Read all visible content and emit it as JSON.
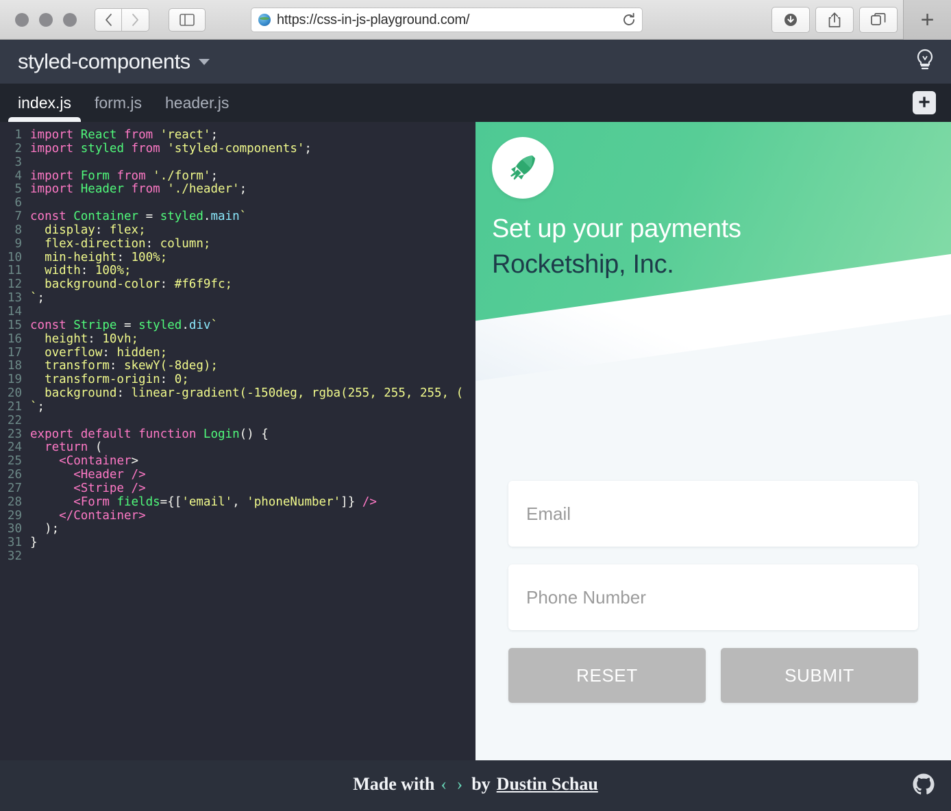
{
  "browser": {
    "url": "https://css-in-js-playground.com/",
    "back_label": "‹",
    "forward_label": "›",
    "new_tab_label": "+",
    "icons": {
      "sidebar": "sidebar-icon",
      "reload": "reload-icon",
      "downloads": "downloads-icon",
      "share": "share-icon",
      "tabs": "tab-overview-icon",
      "globe": "globe-icon"
    }
  },
  "app_header": {
    "project_name": "styled-components",
    "dropdown_icon": "chevron-down-icon",
    "theme_toggle_icon": "lightbulb-icon"
  },
  "tabbar": {
    "tabs": [
      {
        "label": "index.js",
        "active": true
      },
      {
        "label": "form.js",
        "active": false
      },
      {
        "label": "header.js",
        "active": false
      }
    ],
    "add_file_label": "+"
  },
  "editor": {
    "language": "jsx",
    "total_lines": 32,
    "lines": [
      {
        "n": 1,
        "text": "import React from 'react';"
      },
      {
        "n": 2,
        "text": "import styled from 'styled-components';"
      },
      {
        "n": 3,
        "text": ""
      },
      {
        "n": 4,
        "text": "import Form from './form';"
      },
      {
        "n": 5,
        "text": "import Header from './header';"
      },
      {
        "n": 6,
        "text": ""
      },
      {
        "n": 7,
        "text": "const Container = styled.main`"
      },
      {
        "n": 8,
        "text": "  display: flex;"
      },
      {
        "n": 9,
        "text": "  flex-direction: column;"
      },
      {
        "n": 10,
        "text": "  min-height: 100%;"
      },
      {
        "n": 11,
        "text": "  width: 100%;"
      },
      {
        "n": 12,
        "text": "  background-color: #f6f9fc;"
      },
      {
        "n": 13,
        "text": "`;"
      },
      {
        "n": 14,
        "text": ""
      },
      {
        "n": 15,
        "text": "const Stripe = styled.div`"
      },
      {
        "n": 16,
        "text": "  height: 10vh;"
      },
      {
        "n": 17,
        "text": "  overflow: hidden;"
      },
      {
        "n": 18,
        "text": "  transform: skewY(-8deg);"
      },
      {
        "n": 19,
        "text": "  transform-origin: 0;"
      },
      {
        "n": 20,
        "text": "  background: linear-gradient(-150deg, rgba(255, 255, 255, ("
      },
      {
        "n": 21,
        "text": "`;"
      },
      {
        "n": 22,
        "text": ""
      },
      {
        "n": 23,
        "text": "export default function Login() {"
      },
      {
        "n": 24,
        "text": "  return ("
      },
      {
        "n": 25,
        "text": "    <Container>"
      },
      {
        "n": 26,
        "text": "      <Header />"
      },
      {
        "n": 27,
        "text": "      <Stripe />"
      },
      {
        "n": 28,
        "text": "      <Form fields={['email', 'phoneNumber']} />"
      },
      {
        "n": 29,
        "text": "    </Container>"
      },
      {
        "n": 30,
        "text": "  );"
      },
      {
        "n": 31,
        "text": "}"
      },
      {
        "n": 32,
        "text": ""
      }
    ],
    "colors": {
      "background": "#282a36",
      "gutter_text": "#6d8a88",
      "keyword": "#ff79c6",
      "identifier": "#50fa7b",
      "string": "#f1fa8c",
      "plain": "#f8f8f2",
      "member": "#8be9fd"
    }
  },
  "preview": {
    "logo_icon": "rocket-icon",
    "title": "Set up your payments",
    "subtitle": "Rocketship, Inc.",
    "fields": [
      {
        "placeholder": "Email",
        "value": ""
      },
      {
        "placeholder": "Phone Number",
        "value": ""
      }
    ],
    "buttons": [
      {
        "label": "RESET"
      },
      {
        "label": "SUBMIT"
      }
    ],
    "colors": {
      "gradient_start": "#4ec994",
      "gradient_end": "#86dca8",
      "background": "#f4f8fa",
      "button": "#b9b9b9",
      "subtitle_text": "#1d3b49"
    }
  },
  "footer": {
    "made_with": "Made with",
    "code_glyph": "‹ ›",
    "by": "by",
    "author": "Dustin Schau",
    "github_icon": "github-icon",
    "accent_color": "#67d2b5"
  }
}
